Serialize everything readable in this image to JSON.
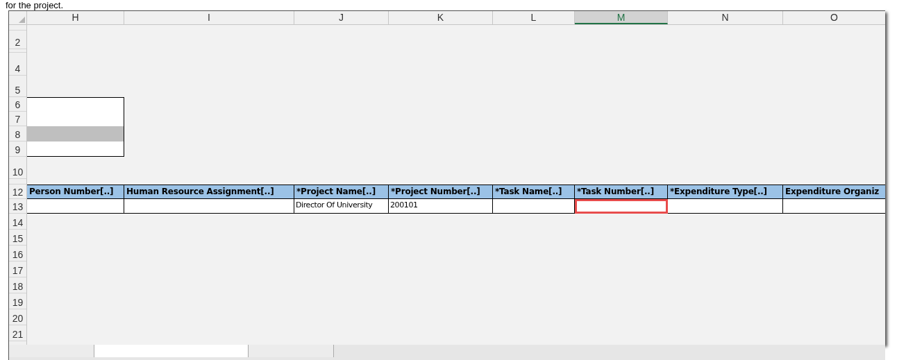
{
  "caption": "for the project.",
  "columns": [
    {
      "label": "H",
      "selected": false
    },
    {
      "label": "I",
      "selected": false
    },
    {
      "label": "J",
      "selected": false
    },
    {
      "label": "K",
      "selected": false
    },
    {
      "label": "L",
      "selected": false
    },
    {
      "label": "M",
      "selected": true
    },
    {
      "label": "N",
      "selected": false
    },
    {
      "label": "O",
      "selected": false
    }
  ],
  "row_headers": [
    "2",
    "4",
    "5",
    "6",
    "7",
    "8",
    "9",
    "10",
    "12",
    "13",
    "14",
    "15",
    "16",
    "17",
    "18",
    "19",
    "20",
    "21"
  ],
  "table": {
    "headers": [
      "Person Number[..]",
      "Human Resource Assignment[..]",
      "*Project Name[..]",
      "*Project Number[..]",
      "*Task Name[..]",
      "*Task Number[..]",
      "*Expenditure Type[..]",
      "Expenditure Organiz"
    ],
    "rows": [
      [
        {
          "text": "",
          "selected": false
        },
        {
          "text": "",
          "selected": false
        },
        {
          "text": "Director Of University",
          "selected": false
        },
        {
          "text": "200101",
          "selected": false
        },
        {
          "text": "",
          "selected": false
        },
        {
          "text": "",
          "selected": true
        },
        {
          "text": "",
          "selected": false
        },
        {
          "text": "",
          "selected": false
        }
      ]
    ]
  },
  "sheet_tabs": [
    {
      "selected": false
    },
    {
      "selected": true
    },
    {
      "selected": false
    }
  ]
}
